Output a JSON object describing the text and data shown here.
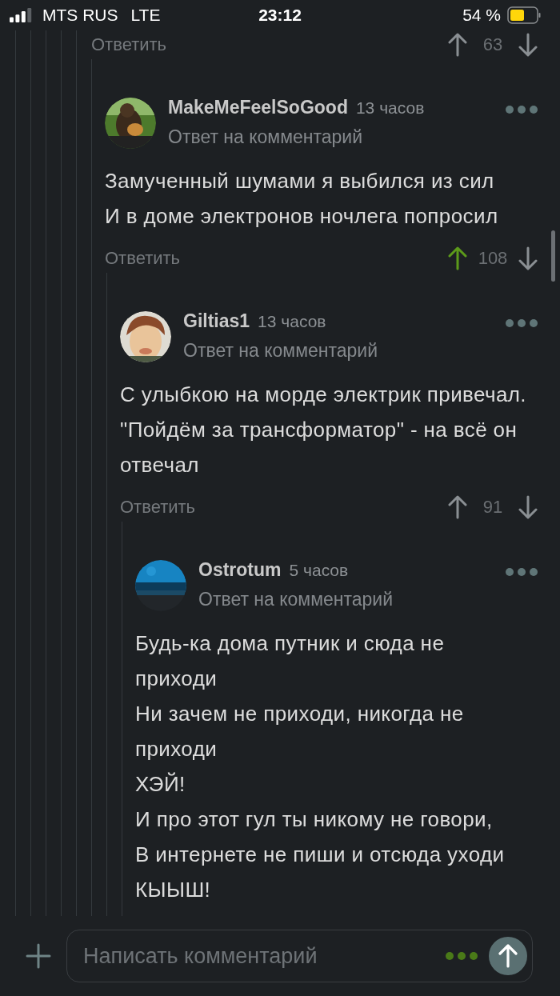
{
  "status_bar": {
    "carrier": "MTS RUS",
    "network": "LTE",
    "time": "23:12",
    "battery": "54 %"
  },
  "parent_actions": {
    "reply_label": "Ответить",
    "score": "63",
    "upvoted": false
  },
  "comments": [
    {
      "author": "MakeMeFeelSoGood",
      "time": "13 часов",
      "subtitle": "Ответ на комментарий",
      "lines": [
        "Замученный шумами я выбился из сил",
        "И в доме электронов ночлега попросил"
      ],
      "reply_label": "Ответить",
      "score": "108",
      "upvoted": true,
      "children": [
        {
          "author": "Giltias1",
          "time": "13 часов",
          "subtitle": "Ответ на комментарий",
          "lines": [
            "С улыбкою на морде электрик привечал.",
            "\"Пойдём за трансформатор\" - на всё он отвечал"
          ],
          "reply_label": "Ответить",
          "score": "91",
          "upvoted": false,
          "children": [
            {
              "author": "Ostrotum",
              "time": "5 часов",
              "subtitle": "Ответ на комментарий",
              "lines": [
                "Будь-ка дома путник и сюда не приходи",
                "Ни зачем не приходи, никогда не приходи",
                "ХЭЙ!",
                "И про этот гул ты никому не говори,",
                "В интернете не пиши и отсюда уходи",
                "КЫЫШ!"
              ]
            }
          ]
        }
      ]
    }
  ],
  "composer": {
    "placeholder": "Написать комментарий"
  }
}
